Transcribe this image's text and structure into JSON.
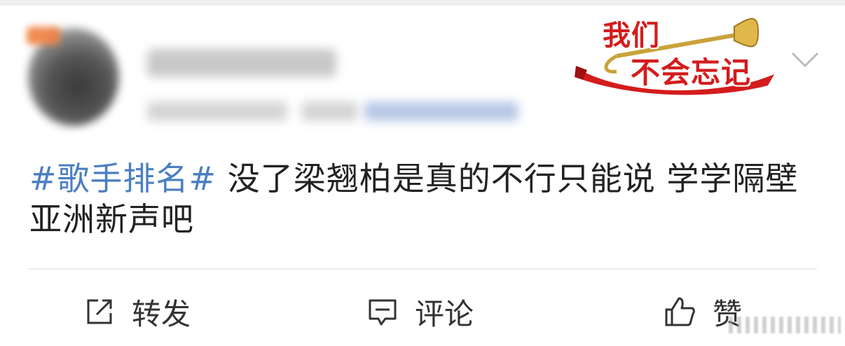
{
  "badge": {
    "line1": "我们",
    "line2": "不会忘记"
  },
  "post": {
    "hashtag": "#歌手排名#",
    "text": " 没了梁翘柏是真的不行只能说 学学隔壁亚洲新声吧"
  },
  "actions": {
    "repost": {
      "label": "转发",
      "icon": "share-icon"
    },
    "comment": {
      "label": "评论",
      "icon": "comment-icon"
    },
    "like": {
      "label": "赞",
      "icon": "thumbs-up-icon"
    }
  },
  "colors": {
    "hashtag": "#4a7fc1",
    "badge_red": "#d41c1c",
    "text": "#222222"
  }
}
